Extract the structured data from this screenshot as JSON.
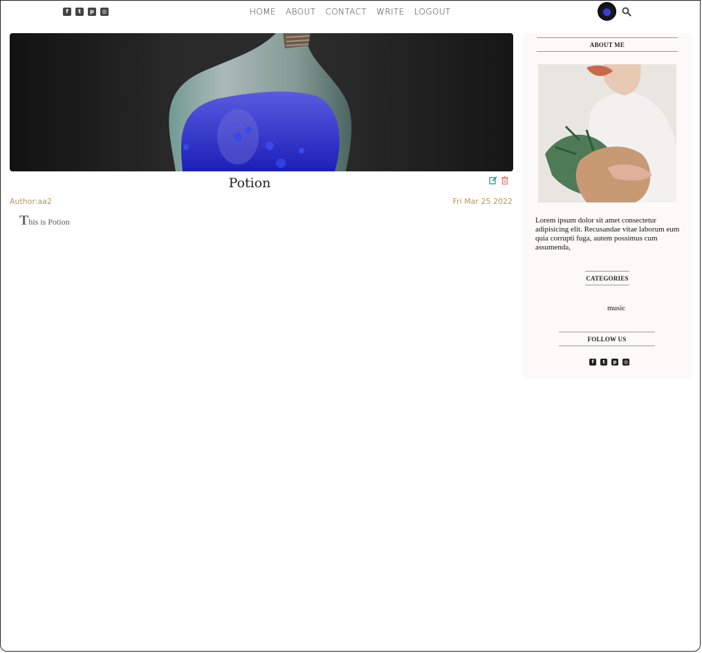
{
  "header": {
    "social": [
      {
        "name": "facebook-icon",
        "glyph": "f"
      },
      {
        "name": "twitter-icon",
        "glyph": "t"
      },
      {
        "name": "pinterest-icon",
        "glyph": "p"
      },
      {
        "name": "instagram-icon",
        "glyph": "◎"
      }
    ],
    "nav": [
      "HOME",
      "ABOUT",
      "CONTACT",
      "WRITE",
      "LOGOUT"
    ]
  },
  "post": {
    "title": "Potion",
    "author": "Author:aa2",
    "date": "Fri Mar 25 2022",
    "body_dropcap": "T",
    "body_rest": "his is Potion"
  },
  "sidebar": {
    "about_title": "ABOUT ME",
    "about_text": "Lorem ipsum dolor sit amet consectetur adipisicing elit. Recusandae vitae laborum eum quia corrupti fuga, autem possimus cum assumenda,",
    "categories_title": "CATEGORIES",
    "categories": [
      "music"
    ],
    "follow_title": "FOLLOW US"
  },
  "colors": {
    "accent": "#b39656",
    "edit": "#1a9b8c",
    "delete": "#e07a6c"
  }
}
